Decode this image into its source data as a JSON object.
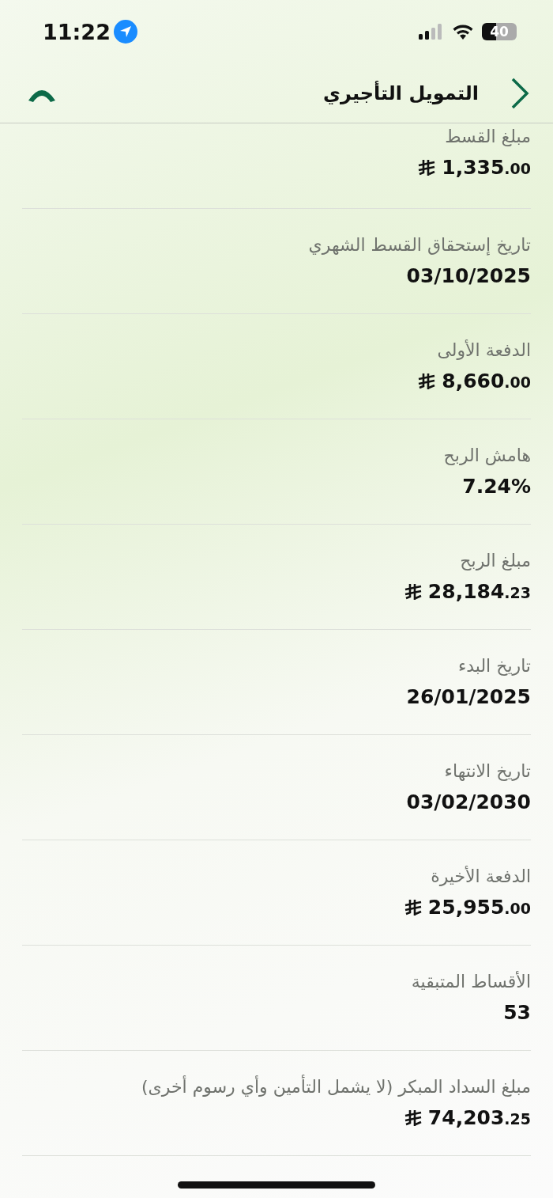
{
  "status_bar": {
    "time": "11:22",
    "battery": "40"
  },
  "header": {
    "title": "التمويل التأجيري"
  },
  "rows": [
    {
      "label": "مبلغ القسط",
      "kind": "money",
      "amount": "1,335",
      "fraction": ".00"
    },
    {
      "label": "تاريخ إستحقاق القسط الشهري",
      "kind": "plain",
      "value": "03/10/2025"
    },
    {
      "label": "الدفعة الأولى",
      "kind": "money",
      "amount": "8,660",
      "fraction": ".00"
    },
    {
      "label": "هامش الربح",
      "kind": "plain",
      "value": "7.24%"
    },
    {
      "label": "مبلغ الربح",
      "kind": "money",
      "amount": "28,184",
      "fraction": ".23"
    },
    {
      "label": "تاريخ البدء",
      "kind": "plain",
      "value": "26/01/2025"
    },
    {
      "label": "تاريخ الانتهاء",
      "kind": "plain",
      "value": "03/02/2030"
    },
    {
      "label": "الدفعة الأخيرة",
      "kind": "money",
      "amount": "25,955",
      "fraction": ".00"
    },
    {
      "label": "الأقساط المتبقية",
      "kind": "plain",
      "value": "53"
    },
    {
      "label": "مبلغ السداد المبكر (لا يشمل التأمين وأي رسوم أخرى)",
      "kind": "money",
      "amount": "74,203",
      "fraction": ".25"
    }
  ]
}
